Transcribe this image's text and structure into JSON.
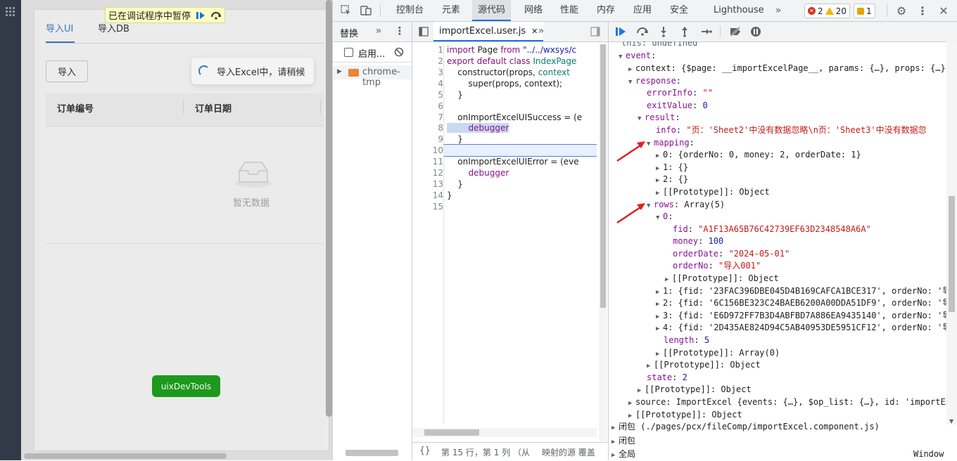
{
  "app": {
    "pause_banner": "已在调试程序中暂停",
    "tabs": [
      "导入UI",
      "导入DB"
    ],
    "import_button": "导入",
    "loading_text": "导入Excel中，请稍候",
    "table_columns": [
      "订单编号",
      "订单日期"
    ],
    "empty_text": "暂无数据",
    "uix_button": "uixDevTools"
  },
  "devtools": {
    "tabs": [
      "控制台",
      "元素",
      "源代码",
      "网络",
      "性能",
      "内存",
      "应用",
      "安全",
      "Lighthouse"
    ],
    "active_tab": "源代码",
    "errors": "2",
    "warnings": "20",
    "issues": "1",
    "navigator": {
      "tab_label": "替换",
      "enable_label": "启用...",
      "folder": "chrome-tmp"
    },
    "editor": {
      "file_tab": "importExcel.user.js",
      "line_numbers": [
        "1",
        "2",
        "3",
        "4",
        "5",
        "6",
        "7",
        "8",
        "9",
        "10",
        "11",
        "12",
        "13",
        "14",
        "15"
      ],
      "status_left": "第 15 行，第 1 列 （从 ",
      "status_right": "映射的源 覆盖"
    },
    "scope": {
      "this_line": "this: undefined",
      "event": "event",
      "context_line": "context: {$page: __importExcelPage__, params: {…}, props: {…},",
      "response": "response",
      "errorInfo_key": "errorInfo",
      "errorInfo_val": "\"\"",
      "exitValue_key": "exitValue",
      "exitValue_val": "0",
      "result": "result",
      "info_key": "info",
      "info_val": "\"页：'Sheet2'中没有数据忽略\\n页：'Sheet3'中没有数据忽",
      "mapping": "mapping",
      "mapping_0": "0: {orderNo: 0, money: 2, orderDate: 1}",
      "mapping_1": "1: {}",
      "mapping_2": "2: {}",
      "proto_object": "[[Prototype]]: Object",
      "rows": "rows",
      "rows_type": "Array(5)",
      "row0": "0",
      "fid_key": "fid",
      "fid_val": "\"A1F13A65B76C42739EF63D2348548A6A\"",
      "money_key": "money",
      "money_val": "100",
      "orderDate_key": "orderDate",
      "orderDate_val": "\"2024-05-01\"",
      "orderNo_key": "orderNo",
      "orderNo_val": "\"导入001\"",
      "row1": "1: {fid: '23FAC396DBE045D4B169CAFCA1BCE317', orderNo: '导",
      "row2": "2: {fid: '6C156BE323C24BAEB6200A00DDA51DF9', orderNo: '导",
      "row3": "3: {fid: 'E6D972FF7B3D4ABFBD7A886EA9435140', orderNo: '导",
      "row4": "4: {fid: '2D435AE824D94C5AB40953DE5951CF12', orderNo: '导",
      "length_key": "length",
      "length_val": "5",
      "proto_array": "[[Prototype]]: Array(0)",
      "state_key": "state",
      "state_val": "2",
      "source_line": "source: ImportExcel {events: {…}, $op_list: {…}, id: 'importExc",
      "closure1": "闭包 (./pages/pcx/fileComp/importExcel.component.js)",
      "closure2": "闭包",
      "global": "全局",
      "global_val": "Window"
    }
  }
}
